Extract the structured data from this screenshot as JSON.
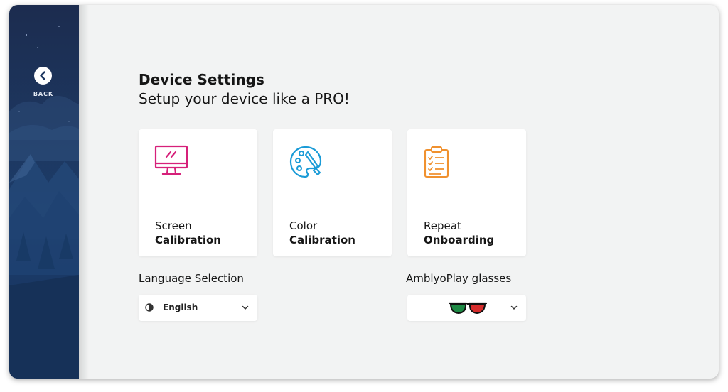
{
  "sidebar": {
    "back_label": "BACK",
    "back_icon": "chevron-left-icon"
  },
  "header": {
    "title": "Device Settings",
    "subtitle": "Setup your device like a PRO!"
  },
  "cards": [
    {
      "icon": "monitor-icon",
      "line1": "Screen",
      "line2": "Calibration",
      "color": "#d6207a"
    },
    {
      "icon": "palette-icon",
      "line1": "Color",
      "line2": "Calibration",
      "color": "#1a9bd7"
    },
    {
      "icon": "clipboard-checklist-icon",
      "line1": "Repeat",
      "line2": "Onboarding",
      "color": "#f0912f"
    }
  ],
  "language": {
    "label": "Language Selection",
    "selected": "English",
    "icon": "globe-icon"
  },
  "glasses": {
    "label": "AmblyoPlay glasses",
    "selected_icon": "green-red-glasses-icon",
    "left_lens_color": "#1e8a45",
    "right_lens_color": "#d62c2c"
  },
  "colors": {
    "background": "#f2f3f3",
    "sidebar": "#1d3760",
    "card": "#ffffff",
    "text": "#161616"
  }
}
